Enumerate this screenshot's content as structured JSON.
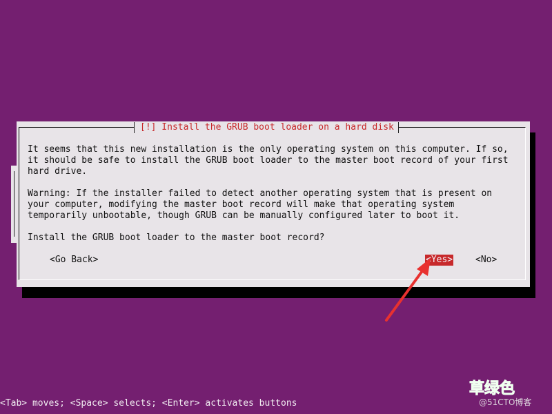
{
  "dialog": {
    "title": "[!] Install the GRUB boot loader on a hard disk",
    "message_1": "It seems that this new installation is the only operating system on this computer. If so,\nit should be safe to install the GRUB boot loader to the master boot record of your first\nhard drive.",
    "message_2": "Warning: If the installer failed to detect another operating system that is present on\nyour computer, modifying the master boot record will make that operating system\ntemporarily unbootable, though GRUB can be manually configured later to boot it.",
    "question": "Install the GRUB boot loader to the master boot record?",
    "buttons": {
      "back": "<Go Back>",
      "yes": "<Yes>",
      "no": "<No>"
    }
  },
  "hint_bar": "<Tab> moves; <Space> selects; <Enter> activates buttons",
  "watermark": {
    "main": "草绿色",
    "sub": "@51CTO博客"
  },
  "colors": {
    "background": "#741f70",
    "dialog": "#e8e4e8",
    "title_red": "#c7292b",
    "selected_button": "#c7292b",
    "arrow": "#e8312f"
  }
}
